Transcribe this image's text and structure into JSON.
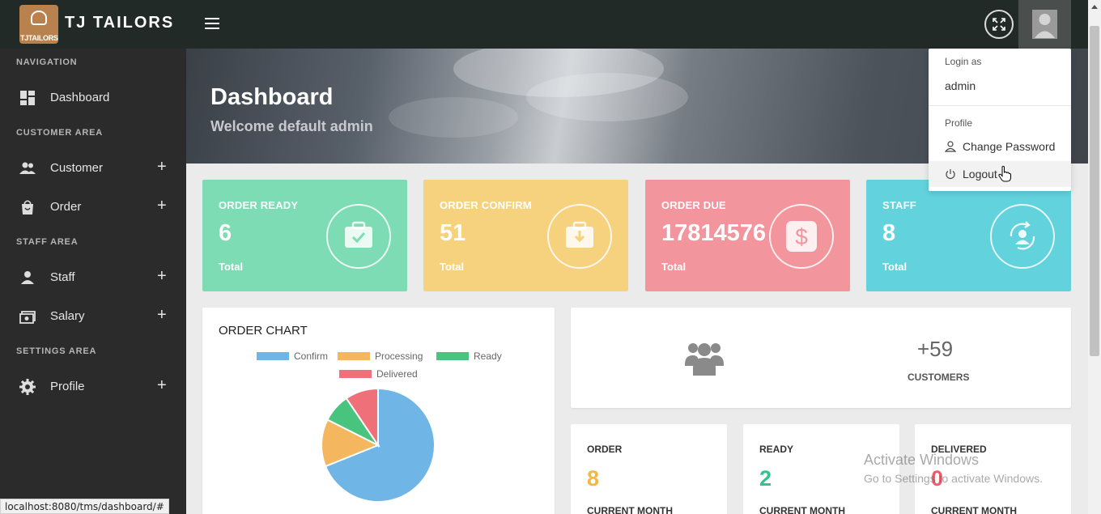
{
  "header": {
    "brand": "TJ TAILORS",
    "logo_text": "TJTAILORS"
  },
  "sidebar": {
    "headings": {
      "navigation": "NAVIGATION",
      "customer_area": "CUSTOMER AREA",
      "staff_area": "STAFF AREA",
      "settings_area": "SETTINGS AREA"
    },
    "items": [
      {
        "label": "Dashboard",
        "icon": "dashboard-icon"
      },
      {
        "label": "Customer",
        "icon": "users-icon",
        "expand": "+"
      },
      {
        "label": "Order",
        "icon": "shopping-bag-icon",
        "expand": "+"
      },
      {
        "label": "Staff",
        "icon": "user-icon",
        "expand": "+"
      },
      {
        "label": "Salary",
        "icon": "money-icon",
        "expand": "+"
      },
      {
        "label": "Profile",
        "icon": "gear-icon",
        "expand": "+"
      }
    ]
  },
  "hero": {
    "title": "Dashboard",
    "subtitle": "Welcome default admin"
  },
  "stats": [
    {
      "title": "ORDER READY",
      "value": "6",
      "label": "Total",
      "color": "#7ddcb4",
      "icon": "briefcase-check-icon"
    },
    {
      "title": "ORDER CONFIRM",
      "value": "51",
      "label": "Total",
      "color": "#f6d27f",
      "icon": "briefcase-download-icon"
    },
    {
      "title": "ORDER DUE",
      "value": "17814576",
      "label": "Total",
      "color": "#f3959c",
      "icon": "dollar-icon"
    },
    {
      "title": "STAFF",
      "value": "8",
      "label": "Total",
      "color": "#62d2dd",
      "icon": "staff-cycle-icon"
    }
  ],
  "order_chart": {
    "title": "ORDER CHART"
  },
  "chart_data": {
    "type": "pie",
    "categories": [
      "Confirm",
      "Processing",
      "Ready",
      "Delivered"
    ],
    "values": [
      51,
      10,
      6,
      7
    ],
    "colors": [
      "#6fb5e6",
      "#f4b760",
      "#48c47e",
      "#f07079"
    ],
    "legend": "top"
  },
  "customers": {
    "value": "+59",
    "label": "CUSTOMERS"
  },
  "mini_stats": [
    {
      "title": "ORDER",
      "value": "8",
      "sub": "CURRENT MONTH",
      "color": "#f4b740"
    },
    {
      "title": "READY",
      "value": "2",
      "sub": "CURRENT MONTH",
      "color": "#32c48d"
    },
    {
      "title": "DELIVERED",
      "value": "0",
      "sub": "CURRENT MONTH",
      "color": "#f05a6a"
    }
  ],
  "dropdown": {
    "login_heading": "Login as",
    "user": "admin",
    "profile_heading": "Profile",
    "change_password": "Change Password",
    "logout": "Logout"
  },
  "statusbar": {
    "url": "localhost:8080/tms/dashboard/#"
  },
  "watermark": {
    "line1": "Activate Windows",
    "line2": "Go to Settings to activate Windows."
  }
}
